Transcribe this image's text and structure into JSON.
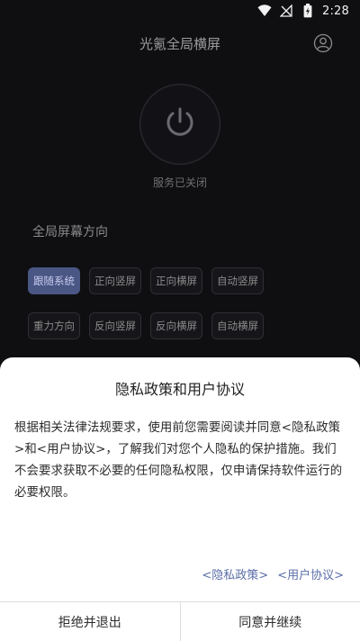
{
  "status_bar": {
    "time": "2:28",
    "icons": [
      "wifi-icon",
      "no-signal-icon",
      "battery-icon"
    ]
  },
  "header": {
    "title": "光氪全局横屏",
    "profile_icon": "user-circle-icon"
  },
  "power": {
    "icon": "power-icon",
    "status_text": "服务已关闭"
  },
  "orientation": {
    "section_label": "全局屏幕方向",
    "options": [
      {
        "label": "跟随系统",
        "active": true
      },
      {
        "label": "正向竖屏",
        "active": false
      },
      {
        "label": "正向横屏",
        "active": false
      },
      {
        "label": "自动竖屏",
        "active": false
      },
      {
        "label": "重力方向",
        "active": false
      },
      {
        "label": "反向竖屏",
        "active": false
      },
      {
        "label": "反向横屏",
        "active": false
      },
      {
        "label": "自动横屏",
        "active": false
      }
    ]
  },
  "privacy_sheet": {
    "title": "隐私政策和用户协议",
    "body": "根据相关法律法规要求，使用前您需要阅读并同意<隐私政策>和<用户协议>，了解我们对您个人隐私的保护措施。我们不会要求获取不必要的任何隐私权限，仅申请保持软件运行的必要权限。",
    "links": {
      "privacy": "<隐私政策>",
      "agreement": "<用户协议>"
    },
    "buttons": {
      "decline": "拒绝并退出",
      "accept": "同意并继续"
    }
  },
  "colors": {
    "background": "#0f0f12",
    "accent": "#4a5684",
    "link": "#5a6ea8"
  }
}
